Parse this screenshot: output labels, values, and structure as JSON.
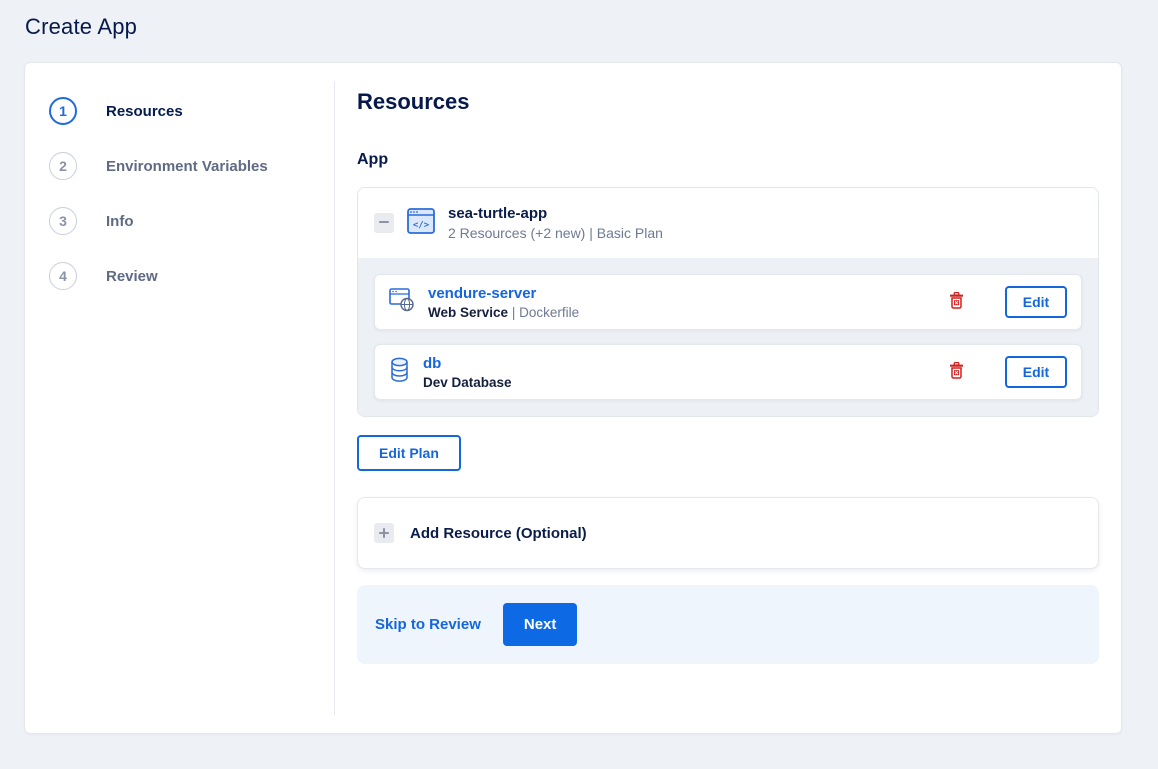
{
  "page": {
    "title": "Create App"
  },
  "stepper": {
    "steps": [
      {
        "number": "1",
        "label": "Resources",
        "active": true
      },
      {
        "number": "2",
        "label": "Environment Variables",
        "active": false
      },
      {
        "number": "3",
        "label": "Info",
        "active": false
      },
      {
        "number": "4",
        "label": "Review",
        "active": false
      }
    ]
  },
  "content": {
    "heading": "Resources",
    "section_label": "App",
    "app_group": {
      "name": "sea-turtle-app",
      "summary": "2 Resources (+2 new) | Basic Plan",
      "edit_button_label": "Edit",
      "resources": [
        {
          "name": "vendure-server",
          "type": "Web Service",
          "detail": "| Dockerfile",
          "icon": "web-service-icon"
        },
        {
          "name": "db",
          "type": "Dev Database",
          "detail": "",
          "icon": "database-icon"
        }
      ]
    },
    "edit_plan_label": "Edit Plan",
    "add_resource_label": "Add Resource (Optional)"
  },
  "footer": {
    "skip_label": "Skip to Review",
    "next_label": "Next"
  },
  "icons": {
    "collapse": "minus-icon",
    "expand": "plus-icon",
    "app": "app-window-code-icon",
    "web_service": "browser-globe-icon",
    "database": "database-cylinder-icon",
    "delete": "trash-icon"
  },
  "colors": {
    "accent_blue": "#1466dc",
    "button_blue": "#0d6ae4",
    "navy_text": "#031b4e",
    "muted_text": "#6e7a92",
    "danger_red": "#d21f1f",
    "page_bg": "#eef1f6",
    "group_body_bg": "#edf0f5",
    "footer_bg": "#eff5fc"
  }
}
